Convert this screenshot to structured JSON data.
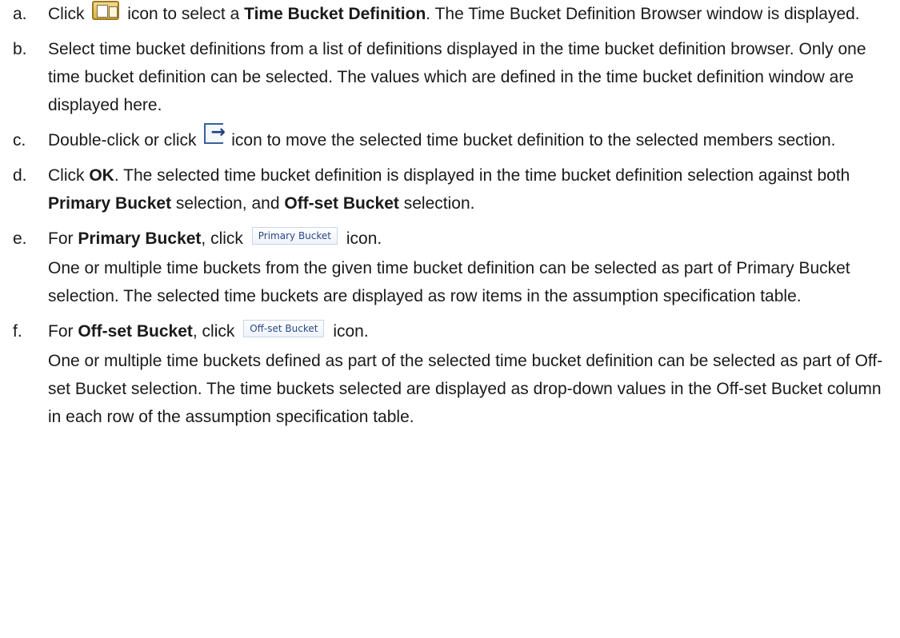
{
  "steps": [
    {
      "marker": "a.",
      "t1": "Click",
      "icon": "folder-browse-icon",
      "t2": "icon to select a",
      "bold1": "Time Bucket Definition",
      "t3": ". The Time Bucket Definition Browser window is displayed."
    },
    {
      "marker": "b.",
      "text": "Select time bucket definitions from a list of definitions displayed in the time bucket definition browser. Only one time bucket definition can be selected. The values which are defined in the time bucket definition window are displayed here."
    },
    {
      "marker": "c.",
      "t1": "Double-click or click",
      "icon": "move-right-icon",
      "t2": "icon to move the selected time bucket definition to the selected members section."
    },
    {
      "marker": "d.",
      "t1": "Click",
      "bold1": "OK",
      "t2": ". The selected time bucket definition is displayed in the time bucket definition selection against both",
      "bold2": "Primary Bucket",
      "t3": "selection, and",
      "bold3": "Off-set Bucket",
      "t4": "selection."
    },
    {
      "marker": "e.",
      "t1": "For",
      "bold1": "Primary Bucket",
      "t2": ", click",
      "button": "Primary Bucket",
      "t3": "icon.",
      "para": "One or multiple time buckets from the given time bucket definition can be selected as part of Primary Bucket selection. The selected time buckets are displayed as row items in the assumption specification table."
    },
    {
      "marker": "f.",
      "t1": "For",
      "bold1": "Off-set Bucket",
      "t2": ", click",
      "button": "Off-set Bucket",
      "t3": "icon.",
      "para": "One or multiple time buckets defined as part of the selected time bucket definition can be selected as part of Off-set Bucket selection. The time buckets selected are displayed as drop-down values in the Off-set Bucket column in each row of the assumption specification table."
    }
  ]
}
